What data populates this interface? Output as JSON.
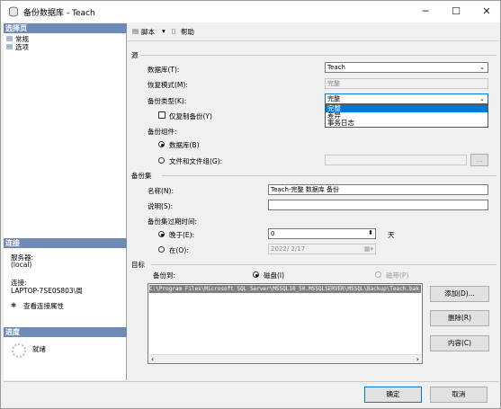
{
  "window": {
    "title": "备份数据库 - Teach",
    "minimize": "─",
    "maximize": "☐",
    "close": "✕"
  },
  "left": {
    "select_page_header": "选择页",
    "pages": [
      "常规",
      "选项"
    ],
    "connection_header": "连接",
    "server_label": "服务器:",
    "server_value": "(local)",
    "connection_label": "连接:",
    "connection_value": "LAPTOP-7SE0S803\\周",
    "view_connection_props": "查看连接属性",
    "progress_header": "进度",
    "progress_status": "就绪"
  },
  "toolbar": {
    "script": "脚本",
    "script_arrow": "▾",
    "help": "帮助"
  },
  "source": {
    "group": "源",
    "database_label": "数据库(T):",
    "database_value": "Teach",
    "recovery_label": "恢复模式(M):",
    "recovery_value": "完整",
    "backup_type_label": "备份类型(K):",
    "backup_type_value": "完整",
    "backup_type_options": [
      "完整",
      "差异",
      "事务日志"
    ],
    "copy_only_label": "仅复制备份(Y)",
    "component_label": "备份组件:",
    "component_db": "数据库(B)",
    "component_files": "文件和文件组(G):",
    "browse": "..."
  },
  "backup_set": {
    "group": "备份集",
    "name_label": "名称(N):",
    "name_value": "Teach-完整 数据库 备份",
    "desc_label": "说明(S):",
    "desc_value": "",
    "expire_label": "备份集过期时间:",
    "after_label": "晚于(E):",
    "after_value": "0",
    "after_unit": "天",
    "on_label": "在(O):",
    "on_value": "2022/ 2/17"
  },
  "destination": {
    "group": "目标",
    "backup_to_label": "备份到:",
    "disk_label": "磁盘(I)",
    "tape_label": "磁带(P)",
    "path": "C:\\Program Files\\Microsoft SQL Server\\MSSQL10_50.MSSQLSERVER\\MSSQL\\Backup\\Teach.bak",
    "add": "添加(D)...",
    "remove": "删除(R)",
    "contents": "内容(C)"
  },
  "footer": {
    "ok": "确定",
    "cancel": "取消"
  }
}
